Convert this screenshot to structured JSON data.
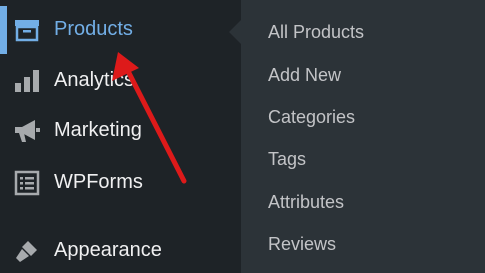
{
  "admin_menu": {
    "items": [
      {
        "label": "Products",
        "icon": "archive-box-icon",
        "active": true
      },
      {
        "label": "Analytics",
        "icon": "bar-chart-icon"
      },
      {
        "label": "Marketing",
        "icon": "megaphone-icon"
      },
      {
        "label": "WPForms",
        "icon": "form-icon"
      },
      {
        "label": "Appearance",
        "icon": "paintbrush-icon"
      }
    ]
  },
  "submenu": {
    "items": [
      {
        "label": "All Products"
      },
      {
        "label": "Add New"
      },
      {
        "label": "Categories"
      },
      {
        "label": "Tags"
      },
      {
        "label": "Attributes"
      },
      {
        "label": "Reviews"
      }
    ]
  },
  "colors": {
    "menu_bg": "#1e2327",
    "submenu_bg": "#2c3338",
    "active_accent": "#72aee6",
    "annotation_arrow": "#dd1a1a"
  }
}
